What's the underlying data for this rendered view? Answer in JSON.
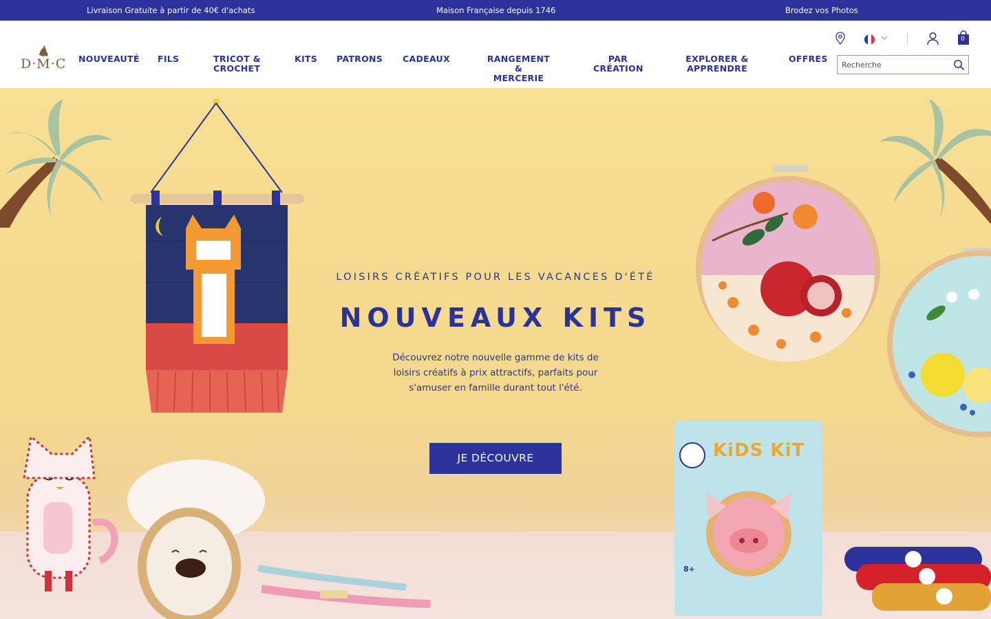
{
  "promo_bar": {
    "items": [
      "Livraison Gratuite à partir de 40€ d'achats",
      "Maison Française depuis 1746",
      "Brodez vos Photos"
    ],
    "bg_color": "#2b3299"
  },
  "header": {
    "logo_text": "D·M·C",
    "nav": [
      "NOUVEAUTÉ",
      "FILS",
      "TRICOT &\nCROCHET",
      "KITS",
      "PATRONS",
      "CADEAUX",
      "RANGEMENT &\nMERCERIE",
      "PAR\nCRÉATION",
      "EXPLORER &\nAPPRENDRE",
      "OFFRES"
    ],
    "search_placeholder": "Recherche",
    "cart_count": "0",
    "language_flag": "fr",
    "icons": [
      "location-icon",
      "flag-icon",
      "chevron-down-icon",
      "user-icon",
      "cart-icon",
      "search-icon"
    ]
  },
  "hero": {
    "eyebrow": "LOISIRS CRÉATIFS POUR LES VACANCES D'ÉTÉ",
    "title": "NOUVEAUX KITS",
    "description": "Découvrez notre nouvelle gamme de kits de loisirs créatifs à prix attractifs, parfaits pour s'amuser en famille durant tout l'été.",
    "cta": "JE DÉCOUVRE",
    "kit_box_text": "KiDS KiT",
    "kit_age": "8+",
    "accent_color": "#2b3299",
    "background_color": "#f4d88d"
  }
}
